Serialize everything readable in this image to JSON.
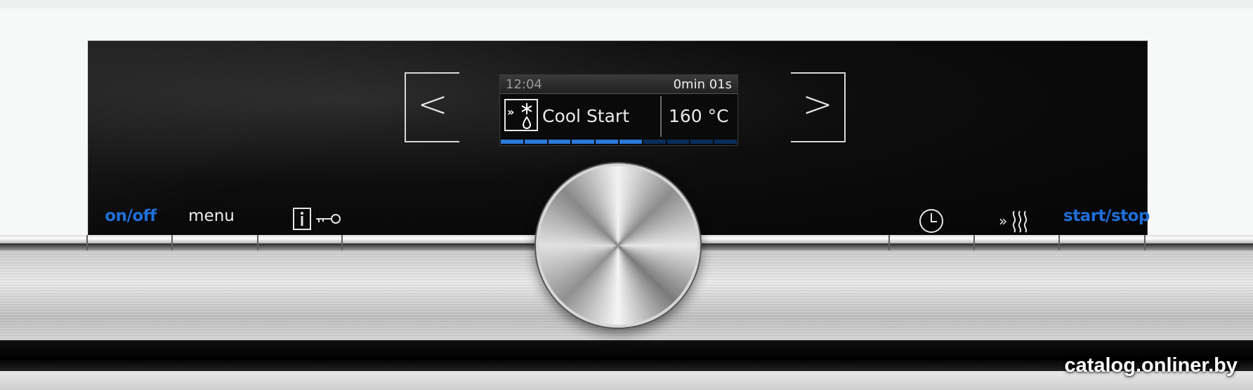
{
  "display": {
    "time": "12:04",
    "remaining": "0min 01s",
    "mode_label": "Cool Start",
    "temperature": "160 °C",
    "progress_segments_total": 10,
    "progress_segments_on": 6
  },
  "nav": {
    "prev": "<",
    "next": ">"
  },
  "controls": {
    "on_off": "on/off",
    "menu": "menu",
    "start_stop": "start/stop"
  },
  "icons": {
    "info_lock": "info-key-lock-icon",
    "timer": "clock-icon",
    "rapid_heat": "rapid-heat-icon",
    "mode": "cool-start-mode-icon",
    "selector": "rotary-knob"
  },
  "colors": {
    "accent_blue": "#1f6fd8",
    "progress_on": "#2c77d6",
    "progress_off": "#0b2d5a"
  },
  "watermark": "catalog.onliner.by"
}
